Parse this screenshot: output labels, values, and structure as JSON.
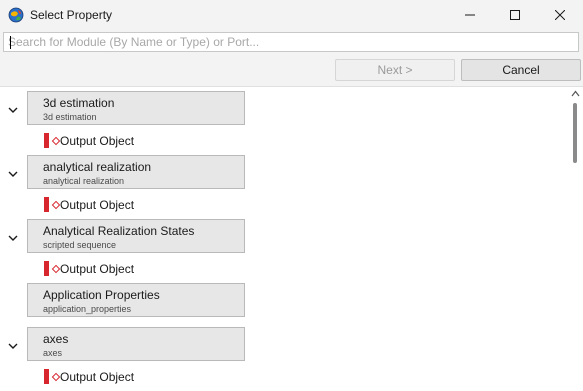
{
  "window": {
    "title": "Select Property",
    "app_icon": "globe-app-icon",
    "controls": [
      "minimize-icon",
      "maximize-icon",
      "close-icon"
    ]
  },
  "search": {
    "value": "",
    "placeholder": "Search for Module (By Name or Type) or Port..."
  },
  "buttons": {
    "next_label": "Next >",
    "cancel_label": "Cancel"
  },
  "modules": [
    {
      "name": "3d estimation",
      "type": "3d estimation",
      "expanded": true,
      "ports": [
        "Output Object"
      ]
    },
    {
      "name": "analytical realization",
      "type": "analytical realization",
      "expanded": true,
      "ports": [
        "Output Object"
      ]
    },
    {
      "name": "Analytical Realization States",
      "type": "scripted sequence",
      "expanded": true,
      "ports": [
        "Output Object"
      ]
    },
    {
      "name": "Application Properties",
      "type": "application_properties",
      "expanded": false,
      "ports": []
    },
    {
      "name": "axes",
      "type": "axes",
      "expanded": true,
      "ports": [
        "Output Object"
      ]
    }
  ],
  "colors": {
    "port_accent": "#d7262e",
    "module_fill": "#e7e7e7",
    "window_bg": "#f3f3f3"
  }
}
